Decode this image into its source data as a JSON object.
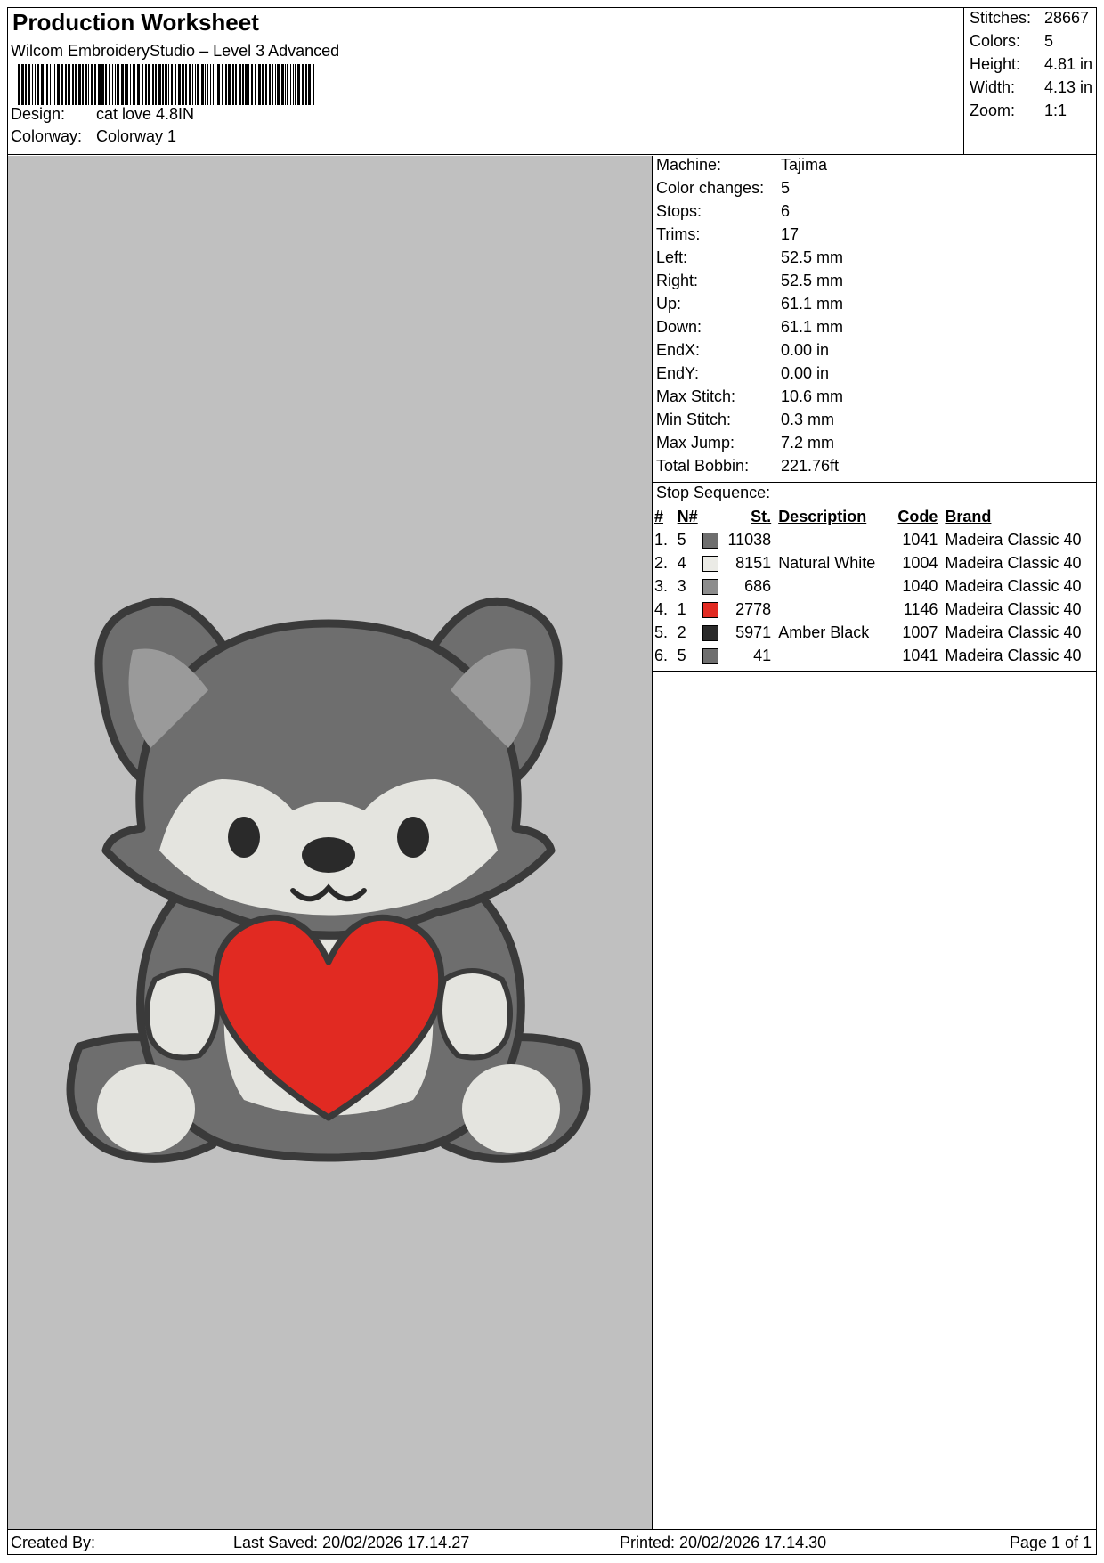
{
  "header": {
    "title": "Production Worksheet",
    "subtitle": "Wilcom EmbroideryStudio – Level 3 Advanced",
    "design_label": "Design:",
    "design_value": "cat love 4.8IN",
    "colorway_label": "Colorway:",
    "colorway_value": "Colorway 1"
  },
  "summary": [
    {
      "label": "Stitches:",
      "value": "28667"
    },
    {
      "label": "Colors:",
      "value": "5"
    },
    {
      "label": "Height:",
      "value": "4.81 in"
    },
    {
      "label": "Width:",
      "value": "4.13 in"
    },
    {
      "label": "Zoom:",
      "value": "1:1"
    }
  ],
  "info": [
    {
      "label": "Machine:",
      "value": "Tajima"
    },
    {
      "label": "Color changes:",
      "value": "5"
    },
    {
      "label": "Stops:",
      "value": "6"
    },
    {
      "label": "Trims:",
      "value": "17"
    },
    {
      "label": "Left:",
      "value": "52.5 mm"
    },
    {
      "label": "Right:",
      "value": "52.5 mm"
    },
    {
      "label": "Up:",
      "value": "61.1 mm"
    },
    {
      "label": "Down:",
      "value": "61.1 mm"
    },
    {
      "label": "EndX:",
      "value": "0.00 in"
    },
    {
      "label": "EndY:",
      "value": "0.00 in"
    },
    {
      "label": "Max Stitch:",
      "value": "10.6 mm"
    },
    {
      "label": "Min Stitch:",
      "value": "0.3 mm"
    },
    {
      "label": "Max Jump:",
      "value": "7.2 mm"
    },
    {
      "label": "Total Bobbin:",
      "value": "221.76ft"
    }
  ],
  "stop_sequence": {
    "title": "Stop Sequence:",
    "headers": {
      "num": "#",
      "n": "N#",
      "st": "St.",
      "desc": "Description",
      "code": "Code",
      "brand": "Brand"
    },
    "rows": [
      {
        "num": "1.",
        "n": "5",
        "color": "#6e6e6e",
        "st": "11038",
        "desc": "",
        "code": "1041",
        "brand": "Madeira Classic 40"
      },
      {
        "num": "2.",
        "n": "4",
        "color": "#ebebe6",
        "st": "8151",
        "desc": "Natural White",
        "code": "1004",
        "brand": "Madeira Classic 40"
      },
      {
        "num": "3.",
        "n": "3",
        "color": "#8c8c8c",
        "st": "686",
        "desc": "",
        "code": "1040",
        "brand": "Madeira Classic 40"
      },
      {
        "num": "4.",
        "n": "1",
        "color": "#e12a22",
        "st": "2778",
        "desc": "",
        "code": "1146",
        "brand": "Madeira Classic 40"
      },
      {
        "num": "5.",
        "n": "2",
        "color": "#2a2a2a",
        "st": "5971",
        "desc": "Amber Black",
        "code": "1007",
        "brand": "Madeira Classic 40"
      },
      {
        "num": "6.",
        "n": "5",
        "color": "#6e6e6e",
        "st": "41",
        "desc": "",
        "code": "1041",
        "brand": "Madeira Classic 40"
      }
    ]
  },
  "footer": {
    "created_by": "Created By:",
    "last_saved": "Last Saved: 20/02/2026 17.14.27",
    "printed": "Printed: 20/02/2026 17.14.30",
    "page": "Page 1 of 1"
  },
  "preview": {
    "background": "#c0c0c0",
    "fur_dark": "#6e6e6e",
    "fur_light": "#e4e4df",
    "outline": "#3a3a3a",
    "heart": "#e12a22"
  }
}
